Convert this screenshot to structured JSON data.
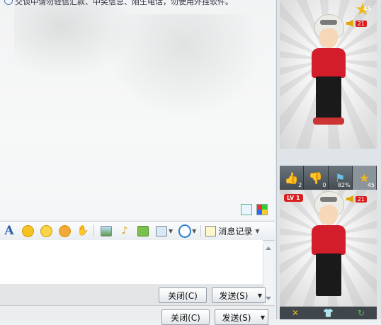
{
  "chat": {
    "notice": "交谈中请勿轻信汇款、中奖信息、陌生电话，勿使用外挂软件。"
  },
  "toolbar": {
    "font_label": "A",
    "history_label": "消息记录"
  },
  "buttons": {
    "close_label": "关闭(C)",
    "send_label": "发送(S)"
  },
  "sidebar": {
    "top_star_count": "45",
    "top_volume_count": "21",
    "stats": [
      {
        "icon": "thumbs-up-icon",
        "count": "2"
      },
      {
        "icon": "thumbs-down-icon",
        "count": "0"
      },
      {
        "icon": "flag-icon",
        "count": "82%"
      },
      {
        "icon": "star-icon",
        "count": "45"
      }
    ],
    "level_badge": "LV 1",
    "bottom_volume_count": "21"
  },
  "colors": {
    "accent": "#2a5ca8",
    "shirt": "#d41d2b",
    "badge_red": "#d81e1e",
    "star": "#f1b81a"
  }
}
